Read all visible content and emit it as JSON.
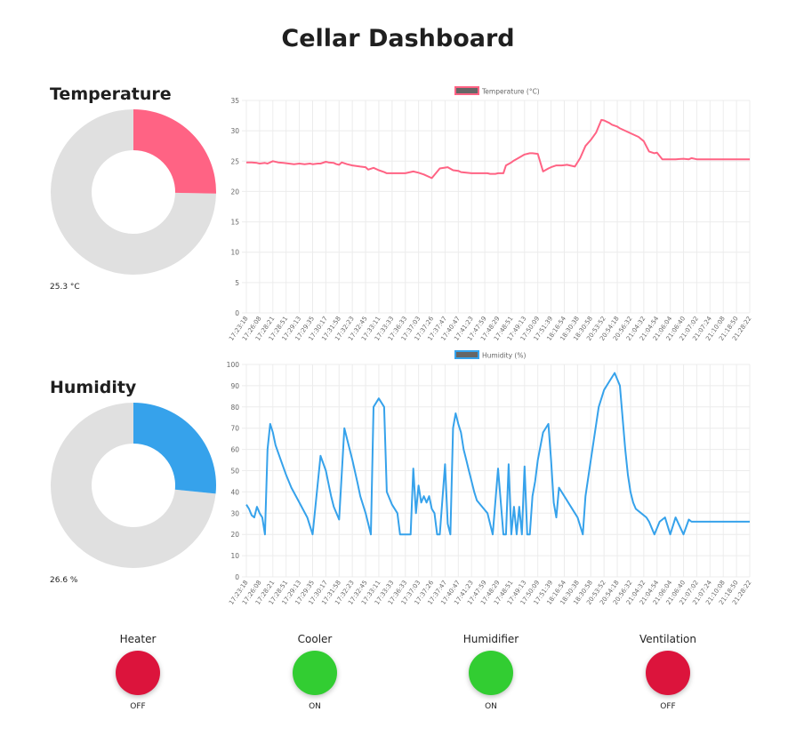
{
  "page": {
    "title": "Cellar Dashboard"
  },
  "gauges": [
    {
      "title": "Temperature",
      "value": 25.3,
      "max": 100,
      "unit": "°C",
      "label": "25.3 °C",
      "color": "#ff6384",
      "track_color": "#e0e0e0"
    },
    {
      "title": "Humidity",
      "value": 26.6,
      "max": 100,
      "unit": "%",
      "label": "26.6 %",
      "color": "#36a2eb",
      "track_color": "#e0e0e0"
    }
  ],
  "chart_data": [
    {
      "type": "line",
      "title": "",
      "xlabel": "",
      "ylabel": "",
      "ylim": [
        0,
        35
      ],
      "yticks": [
        0,
        5,
        10,
        15,
        20,
        25,
        30,
        35
      ],
      "grid": true,
      "legend": "top-center",
      "x_tick_labels": [
        "17:23:18",
        "17:26:08",
        "17:28:21",
        "17:28:51",
        "17:29:13",
        "17:29:35",
        "17:30:17",
        "17:31:58",
        "17:32:23",
        "17:32:45",
        "17:33:11",
        "17:33:33",
        "17:36:33",
        "17:37:03",
        "17:37:26",
        "17:37:47",
        "17:40:47",
        "17:41:23",
        "17:47:59",
        "17:48:29",
        "17:48:51",
        "17:49:13",
        "17:50:09",
        "17:51:39",
        "18:16:54",
        "18:30:38",
        "18:30:58",
        "20:53:52",
        "20:54:18",
        "20:56:32",
        "21:04:32",
        "21:04:54",
        "21:06:04",
        "21:06:40",
        "21:07:02",
        "21:07:24",
        "21:10:08",
        "21:18:50",
        "21:28:22"
      ],
      "series": [
        {
          "name": "Temperature (°C)",
          "color": "#ff6384",
          "x": [
            0,
            2,
            4,
            5,
            7,
            8,
            10,
            12,
            14,
            16,
            18,
            20,
            22,
            24,
            25,
            27,
            28,
            30,
            31,
            33,
            34,
            35,
            36,
            38,
            40,
            43,
            45,
            46,
            48,
            50,
            52,
            53,
            55,
            58,
            60,
            63,
            65,
            67,
            70,
            73,
            76,
            78,
            80,
            81,
            83,
            85,
            87,
            88,
            90,
            91,
            92,
            94,
            95,
            97,
            98,
            100,
            101,
            103,
            105,
            107,
            108,
            110,
            112,
            114,
            115,
            117,
            119,
            121,
            124,
            126,
            128,
            130,
            132,
            134,
            135,
            137,
            138,
            140,
            141,
            143,
            145,
            148,
            150,
            152,
            154,
            155,
            157,
            160,
            162,
            165,
            167,
            168,
            170,
            172,
            173,
            175,
            176,
            177,
            178,
            180,
            182,
            185,
            186,
            187,
            188,
            190
          ],
          "y": [
            24.8,
            24.8,
            24.7,
            24.6,
            24.7,
            24.6,
            25,
            24.8,
            24.7,
            24.6,
            24.5,
            24.6,
            24.5,
            24.6,
            24.5,
            24.6,
            24.6,
            24.9,
            24.8,
            24.7,
            24.5,
            24.4,
            24.8,
            24.5,
            24.3,
            24.1,
            24,
            23.6,
            23.9,
            23.5,
            23.2,
            23,
            23,
            23,
            23,
            23.3,
            23.1,
            22.8,
            22.2,
            23.8,
            24,
            23.5,
            23.4,
            23.2,
            23.1,
            23,
            23,
            23,
            23,
            23,
            22.9,
            22.9,
            23,
            23,
            24.3,
            24.8,
            25.1,
            25.6,
            26.1,
            26.3,
            26.3,
            26.2,
            23.3,
            23.8,
            24,
            24.3,
            24.3,
            24.4,
            24.1,
            25.5,
            27.5,
            28.5,
            29.7,
            31.8,
            31.7,
            31.3,
            31,
            30.7,
            30.4,
            30,
            29.6,
            29,
            28.3,
            26.6,
            26.3,
            26.4,
            25.3,
            25.3,
            25.3,
            25.4,
            25.3,
            25.5,
            25.3,
            25.3,
            25.3,
            25.3,
            25.3,
            25.3,
            25.3,
            25.3,
            25.3,
            25.3,
            25.3,
            25.3,
            25.3,
            25.3
          ]
        }
      ]
    },
    {
      "type": "line",
      "title": "",
      "xlabel": "",
      "ylabel": "",
      "ylim": [
        0,
        100
      ],
      "yticks": [
        0,
        10,
        20,
        30,
        40,
        50,
        60,
        70,
        80,
        90,
        100
      ],
      "grid": true,
      "legend": "top-center",
      "x_tick_labels": [
        "17:23:18",
        "17:26:08",
        "17:28:21",
        "17:28:51",
        "17:29:13",
        "17:29:35",
        "17:30:17",
        "17:31:58",
        "17:32:23",
        "17:32:45",
        "17:33:11",
        "17:33:33",
        "17:36:33",
        "17:37:03",
        "17:37:26",
        "17:37:47",
        "17:40:47",
        "17:41:23",
        "17:47:59",
        "17:48:29",
        "17:48:51",
        "17:49:13",
        "17:50:09",
        "17:51:39",
        "18:16:54",
        "18:30:38",
        "18:30:58",
        "20:53:52",
        "20:54:18",
        "20:56:32",
        "21:04:32",
        "21:04:54",
        "21:06:04",
        "21:06:40",
        "21:07:02",
        "21:07:24",
        "21:10:08",
        "21:18:50",
        "21:28:22"
      ],
      "series": [
        {
          "name": "Humidity (%)",
          "color": "#36a2eb",
          "x": [
            0,
            1,
            2,
            3,
            4,
            5,
            6,
            7,
            8,
            9,
            10,
            11,
            13,
            15,
            17,
            20,
            23,
            25,
            28,
            30,
            31,
            32,
            33,
            35,
            37,
            38,
            40,
            42,
            43,
            45,
            47,
            48,
            50,
            52,
            53,
            55,
            57,
            58,
            60,
            62,
            63,
            64,
            65,
            66,
            67,
            68,
            69,
            70,
            71,
            72,
            73,
            75,
            76,
            77,
            78,
            79,
            80,
            81,
            82,
            83,
            84,
            85,
            86,
            87,
            89,
            91,
            93,
            95,
            97,
            98,
            99,
            100,
            101,
            102,
            103,
            104,
            105,
            106,
            107,
            108,
            109,
            110,
            112,
            114,
            115,
            116,
            117,
            118,
            120,
            122,
            124,
            125,
            127,
            128,
            130,
            133,
            135,
            137,
            139,
            141,
            142,
            143,
            144,
            145,
            146,
            147,
            149,
            151,
            152,
            154,
            156,
            158,
            160,
            162,
            165,
            167,
            168,
            170,
            172,
            174,
            176,
            178,
            180,
            182,
            184,
            186,
            187,
            188,
            189,
            190
          ],
          "y": [
            34,
            32,
            29,
            28,
            33,
            30,
            28,
            20,
            60,
            72,
            68,
            62,
            55,
            48,
            42,
            35,
            28,
            20,
            57,
            50,
            44,
            38,
            33,
            27,
            70,
            65,
            55,
            44,
            38,
            30,
            20,
            80,
            84,
            80,
            40,
            34,
            30,
            20,
            20,
            20,
            51,
            30,
            43,
            35,
            38,
            35,
            38,
            32,
            30,
            20,
            20,
            53,
            25,
            20,
            70,
            77,
            72,
            68,
            60,
            55,
            50,
            45,
            40,
            36,
            33,
            30,
            20,
            51,
            20,
            20,
            53,
            20,
            33,
            20,
            33,
            20,
            52,
            20,
            20,
            38,
            45,
            55,
            68,
            72,
            55,
            35,
            28,
            42,
            38,
            34,
            30,
            28,
            20,
            38,
            55,
            80,
            88,
            92,
            96,
            90,
            75,
            60,
            48,
            40,
            35,
            32,
            30,
            28,
            26,
            20,
            26,
            28,
            20,
            28,
            20,
            27,
            26,
            26,
            26,
            26,
            26,
            26,
            26,
            26,
            26,
            26,
            26,
            26,
            26,
            26
          ]
        }
      ]
    }
  ],
  "devices": [
    {
      "name": "Heater",
      "state": "OFF",
      "color": "#dc143c"
    },
    {
      "name": "Cooler",
      "state": "ON",
      "color": "#32cd32"
    },
    {
      "name": "Humidifier",
      "state": "ON",
      "color": "#32cd32"
    },
    {
      "name": "Ventilation",
      "state": "OFF",
      "color": "#dc143c"
    }
  ]
}
